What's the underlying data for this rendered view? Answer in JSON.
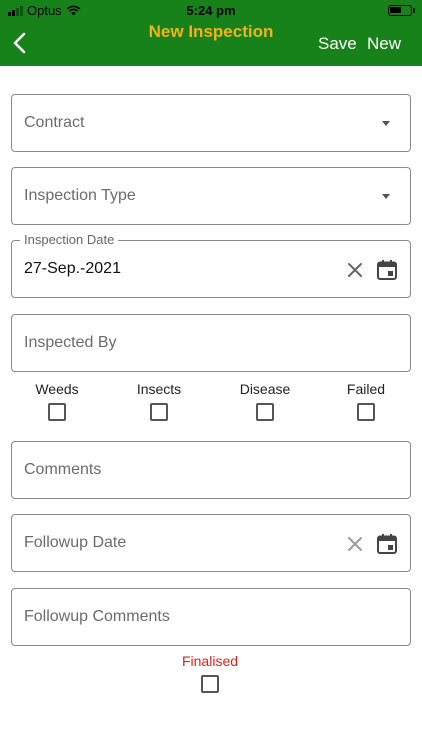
{
  "status_bar": {
    "carrier": "Optus",
    "time": "5:24 pm"
  },
  "header": {
    "title": "New Inspection",
    "save_label": "Save",
    "new_label": "New"
  },
  "form": {
    "contract": {
      "placeholder": "Contract"
    },
    "inspection_type": {
      "placeholder": "Inspection Type"
    },
    "inspection_date": {
      "label": "Inspection Date",
      "value": "27-Sep.-2021"
    },
    "inspected_by": {
      "placeholder": "Inspected By"
    },
    "checkboxes": [
      {
        "label": "Weeds",
        "checked": false
      },
      {
        "label": "Insects",
        "checked": false
      },
      {
        "label": "Disease",
        "checked": false
      },
      {
        "label": "Failed",
        "checked": false
      }
    ],
    "comments": {
      "placeholder": "Comments"
    },
    "followup_date": {
      "placeholder": "Followup Date"
    },
    "followup_comments": {
      "placeholder": "Followup Comments"
    },
    "finalised": {
      "label": "Finalised",
      "checked": false
    }
  },
  "colors": {
    "header_bg": "#18821a",
    "title": "#f2b21b",
    "finalised_label": "#e02020"
  },
  "icons": [
    "back-chevron-icon",
    "dropdown-caret-icon",
    "clear-icon",
    "calendar-icon",
    "wifi-icon",
    "battery-icon"
  ]
}
